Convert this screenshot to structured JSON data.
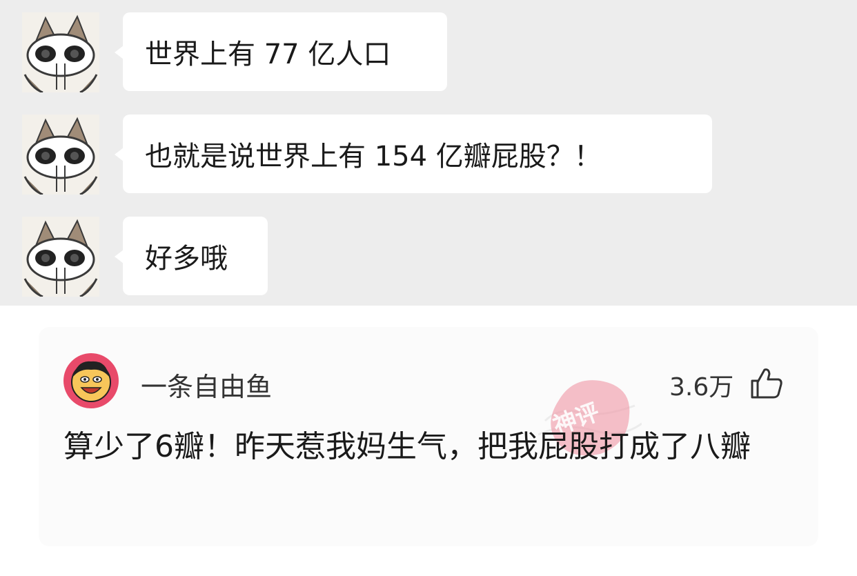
{
  "chat": {
    "messages": [
      {
        "text": "世界上有 77 亿人口"
      },
      {
        "text": "也就是说世界上有 154 亿瓣屁股？！"
      },
      {
        "text": "好多哦"
      }
    ]
  },
  "comment": {
    "username": "一条自由鱼",
    "likes": "3.6万",
    "text": "算少了6瓣！昨天惹我妈生气，把我屁股打成了八瓣",
    "watermark": "神评"
  },
  "icons": {
    "cat_avatar": "cat-avatar-icon",
    "user_avatar": "cartoon-face-avatar-icon",
    "like": "thumbs-up-icon",
    "watermark": "stamp-watermark-icon"
  },
  "colors": {
    "chat_background": "#ededed",
    "bubble": "#ffffff",
    "card_background": "#fbfbfb",
    "text": "#1a1a1a",
    "watermark": "#e8506a"
  }
}
